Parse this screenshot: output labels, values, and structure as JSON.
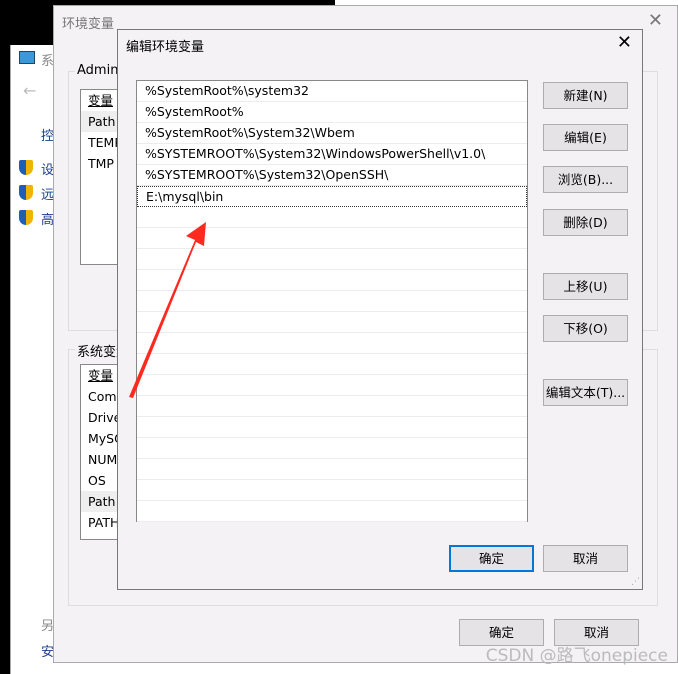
{
  "background_window": {
    "title": "系统",
    "items": [
      "控",
      "设",
      "远",
      "高",
      "另",
      "安"
    ]
  },
  "env_window": {
    "title": "环境变量",
    "user_group": "Adminis",
    "user_vars_header": "变量",
    "user_vars": [
      "Path",
      "TEMP",
      "TMP"
    ],
    "system_group": "系统变量",
    "system_vars_header": "变量",
    "system_vars": [
      "ComS",
      "Drive",
      "MySQ",
      "NUM",
      "OS",
      "Path",
      "PATH"
    ],
    "ok": "确定",
    "cancel": "取消"
  },
  "edit_dialog": {
    "title": "编辑环境变量",
    "close": "✕",
    "paths": [
      "%SystemRoot%\\system32",
      "%SystemRoot%",
      "%SystemRoot%\\System32\\Wbem",
      "%SYSTEMROOT%\\System32\\WindowsPowerShell\\v1.0\\",
      "%SYSTEMROOT%\\System32\\OpenSSH\\",
      "E:\\mysql\\bin"
    ],
    "selected_index": 5,
    "buttons": {
      "new": "新建(N)",
      "edit": "编辑(E)",
      "browse": "浏览(B)...",
      "delete": "删除(D)",
      "move_up": "上移(U)",
      "move_down": "下移(O)",
      "edit_text": "编辑文本(T)..."
    },
    "ok": "确定",
    "cancel": "取消"
  },
  "annotation_color": "#ff2a1f",
  "watermark": "CSDN @路飞onepiece"
}
